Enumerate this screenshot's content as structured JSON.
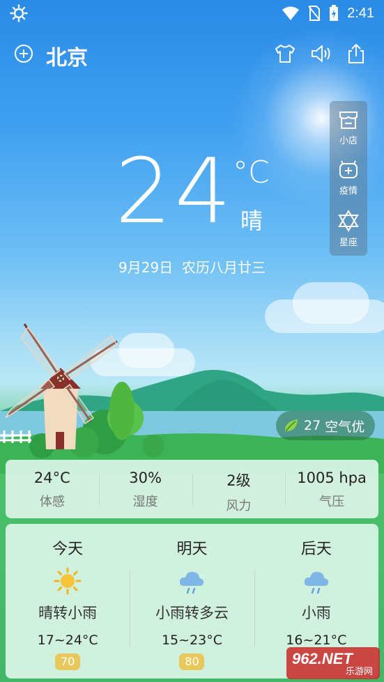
{
  "status_bar": {
    "time": "2:41",
    "icons": [
      "brightness-icon",
      "wifi-icon",
      "no-sim-icon",
      "battery-charging-icon"
    ]
  },
  "header": {
    "city": "北京",
    "icons": [
      "add-city-icon",
      "tshirt-icon",
      "speaker-icon",
      "share-icon"
    ]
  },
  "side_panel": {
    "items": [
      {
        "label": "小店",
        "icon": "shop-icon"
      },
      {
        "label": "疫情",
        "icon": "medical-icon"
      },
      {
        "label": "星座",
        "icon": "star-of-david-icon"
      }
    ]
  },
  "current": {
    "temperature": "24",
    "unit": "°C",
    "condition": "晴",
    "date": "9月29日",
    "lunar": "农历八月廿三"
  },
  "air_quality": {
    "value": "27",
    "label": "空气优",
    "icon": "leaf-icon"
  },
  "stats": [
    {
      "value": "24°C",
      "name": "体感"
    },
    {
      "value": "30%",
      "name": "湿度"
    },
    {
      "value": "2级",
      "name": "风力"
    },
    {
      "value": "1005 hpa",
      "name": "气压"
    }
  ],
  "forecast": [
    {
      "day": "今天",
      "icon": "sun-icon",
      "desc": "晴转小雨",
      "range": "17~24°C",
      "aqi": "70"
    },
    {
      "day": "明天",
      "icon": "rain-cloud-icon",
      "desc": "小雨转多云",
      "range": "15~23°C",
      "aqi": "80"
    },
    {
      "day": "后天",
      "icon": "rain-cloud-icon",
      "desc": "小雨",
      "range": "16~21°C",
      "aqi": ""
    }
  ],
  "watermark": {
    "line1": "962.NET",
    "line2": "乐游网"
  },
  "colors": {
    "sky_top": "#2a8be6",
    "grass": "#43b86a",
    "aqi_badge": "#e8c85a",
    "card_bg": "#dcf5e8"
  }
}
